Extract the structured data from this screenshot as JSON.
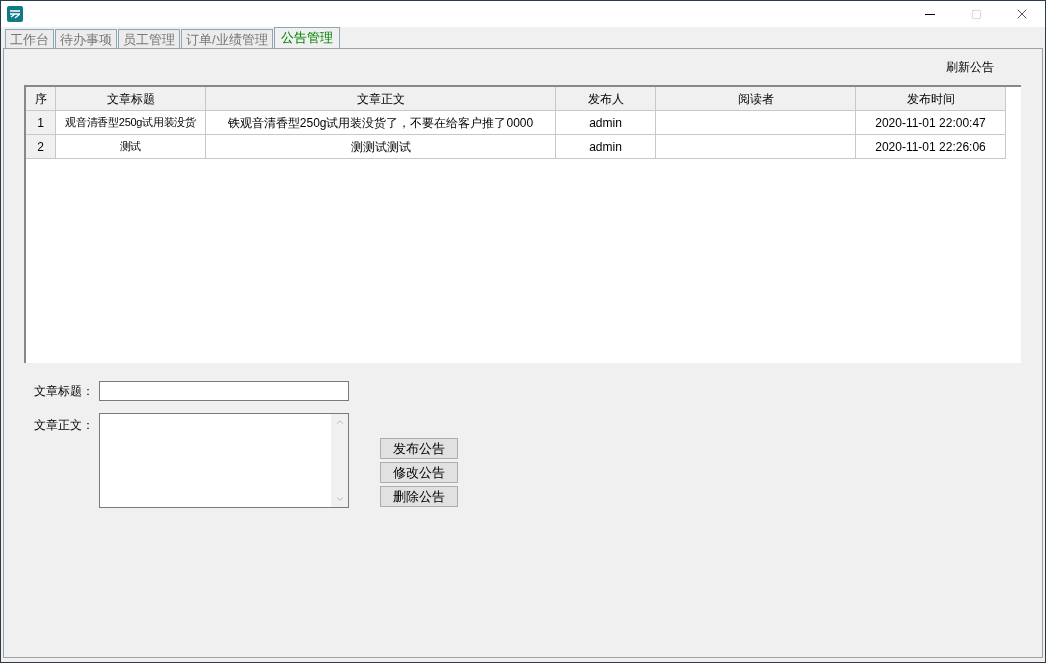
{
  "tabs": [
    {
      "label": "工作台",
      "selected": false
    },
    {
      "label": "待办事项",
      "selected": false
    },
    {
      "label": "员工管理",
      "selected": false
    },
    {
      "label": "订单/业绩管理",
      "selected": false
    },
    {
      "label": "公告管理",
      "selected": true
    }
  ],
  "refresh_button": "刷新公告",
  "table": {
    "columns": [
      "序",
      "文章标题",
      "文章正文",
      "发布人",
      "阅读者",
      "发布时间"
    ],
    "rows": [
      [
        "1",
        "观音清香型250g试用装没货",
        "铁观音清香型250g试用装没货了，不要在给客户推了0000",
        "admin",
        "",
        "2020-11-01 22:00:47"
      ],
      [
        "2",
        "测试",
        "测测试测试",
        "admin",
        "",
        "2020-11-01 22:26:06"
      ]
    ]
  },
  "form": {
    "title_label": "文章标题：",
    "body_label": "文章正文："
  },
  "buttons": [
    "发布公告",
    "修改公告",
    "删除公告"
  ]
}
